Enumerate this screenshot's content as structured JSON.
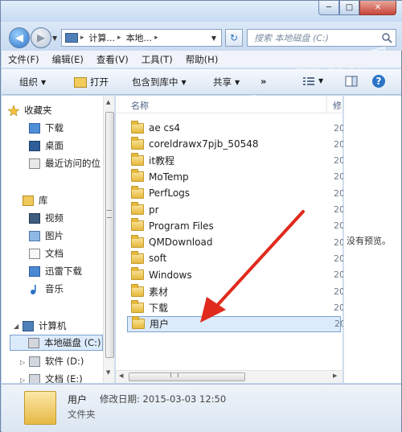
{
  "window": {
    "buttons": {
      "minimize": "─",
      "maximize": "□",
      "close": "✕"
    }
  },
  "address_bar": {
    "crumbs": [
      "计算...",
      "本地..."
    ],
    "separator": "▸",
    "refresh_icon": "refresh-icon"
  },
  "search": {
    "placeholder": "搜索 本地磁盘 (C:)"
  },
  "menu": [
    "文件(F)",
    "编辑(E)",
    "查看(V)",
    "工具(T)",
    "帮助(H)"
  ],
  "toolbar": {
    "organize": "组织",
    "open": "打开",
    "include_library": "包含到库中",
    "share": "共享",
    "more": "»"
  },
  "nav_pane": {
    "favorites": {
      "label": "收藏夹",
      "items": [
        "下载",
        "桌面",
        "最近访问的位"
      ]
    },
    "libraries": {
      "label": "库",
      "items": [
        "视频",
        "图片",
        "文档",
        "迅雷下载",
        "音乐"
      ]
    },
    "computer": {
      "label": "计算机",
      "items": [
        "本地磁盘 (C:)",
        "软件 (D:)",
        "文档 (E:)"
      ]
    }
  },
  "file_list": {
    "column_name": "名称",
    "column_cut": "修",
    "cut_value": "20",
    "rows": [
      "ae cs4",
      "coreldrawx7pjb_50548",
      "it教程",
      "MoTemp",
      "PerfLogs",
      "pr",
      "Program Files",
      "QMDownload",
      "soft",
      "Windows",
      "素材",
      "下载",
      "用户"
    ],
    "selected": "用户"
  },
  "preview": {
    "message": "没有预览。"
  },
  "details": {
    "name": "用户",
    "modified": "修改日期: 2015-03-03 12:50",
    "type": "文件夹"
  },
  "colors": {
    "selection": "#dcebfc",
    "selection_border": "#7da2ce",
    "arrow": "#e02a1c",
    "frame": "#c4d9ef"
  }
}
